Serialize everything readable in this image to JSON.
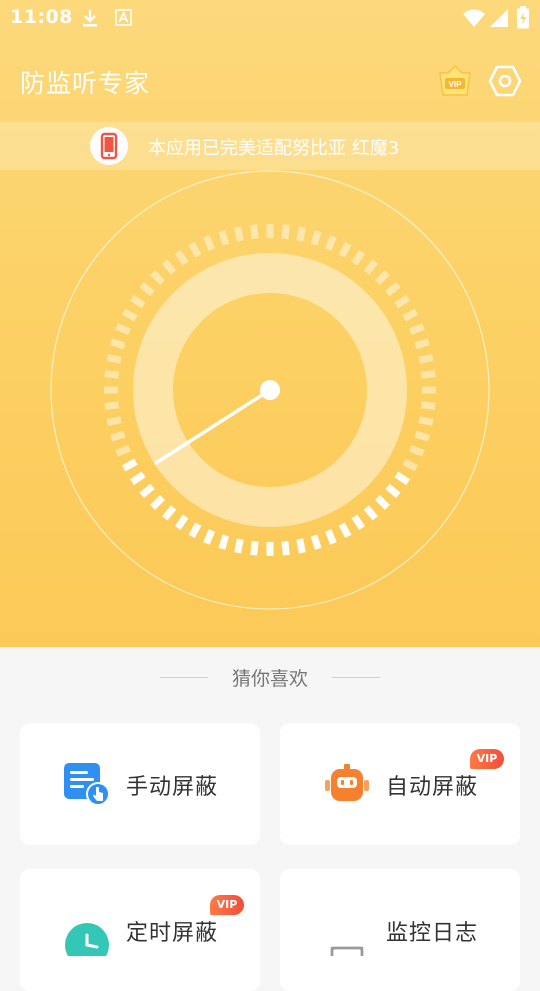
{
  "status_bar": {
    "time": "11:08"
  },
  "header": {
    "title": "防监听专家"
  },
  "banner": {
    "text": "本应用已完美适配努比亚 红魔3"
  },
  "section": {
    "title": "猜你喜欢"
  },
  "cards": [
    {
      "label": "手动屏蔽",
      "icon": "manual-block-icon",
      "vip": false
    },
    {
      "label": "自动屏蔽",
      "icon": "robot-icon",
      "vip": true,
      "badge": "VIP"
    },
    {
      "label": "定时屏蔽",
      "icon": "clock-icon",
      "vip": true,
      "badge": "VIP"
    },
    {
      "label": "监控日志",
      "icon": "log-icon",
      "vip": false
    }
  ],
  "vip_icon_label": "VIP",
  "colors": {
    "hero_top": "#fdd97c",
    "hero_bottom": "#fbc957",
    "vip_badge": "#f24d3a",
    "manual_icon": "#2f8ff2",
    "robot_icon": "#f5812f",
    "clock_icon": "#34c7b5"
  }
}
